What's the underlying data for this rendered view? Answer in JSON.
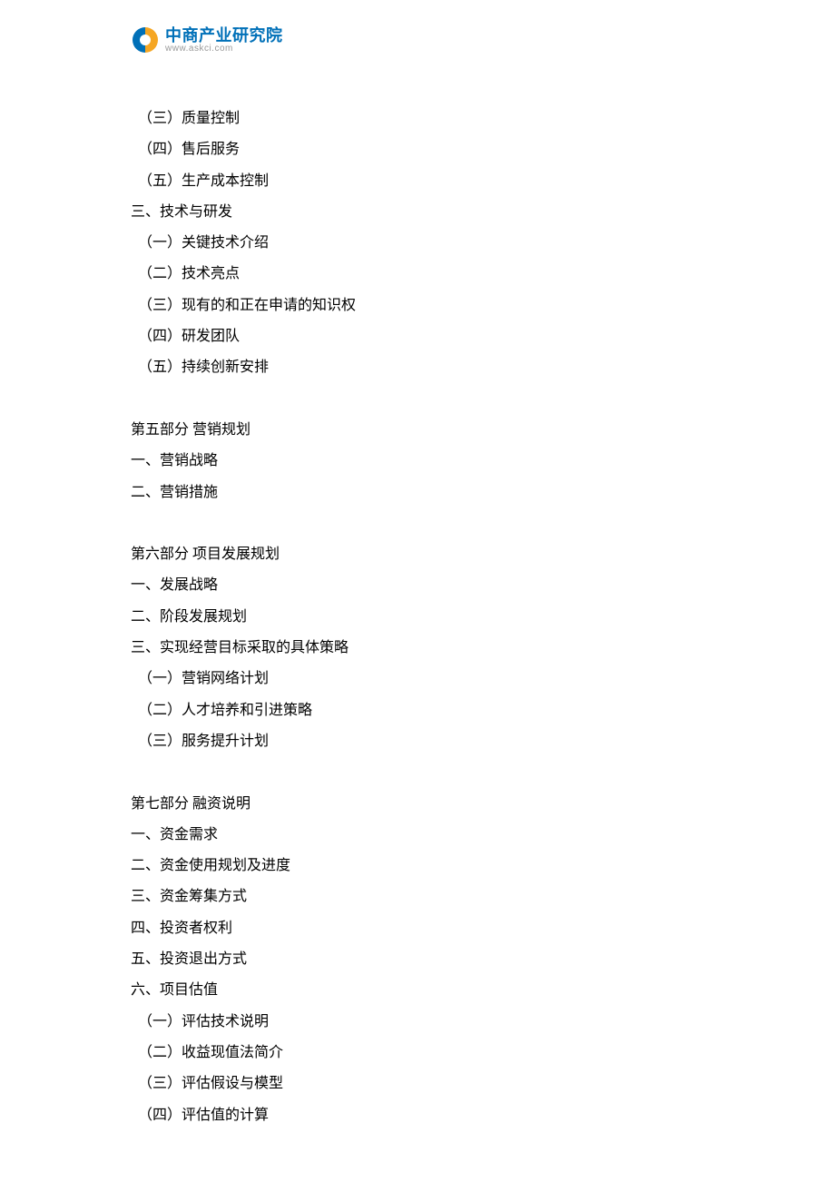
{
  "logo": {
    "chinese": "中商产业研究院",
    "url": "www.askci.com"
  },
  "lines": [
    {
      "text": "（三）质量控制",
      "sub": true
    },
    {
      "text": "（四）售后服务",
      "sub": true
    },
    {
      "text": "（五）生产成本控制",
      "sub": true
    },
    {
      "text": "三、技术与研发",
      "sub": false
    },
    {
      "text": "（一）关键技术介绍",
      "sub": true
    },
    {
      "text": "（二）技术亮点",
      "sub": true
    },
    {
      "text": "（三）现有的和正在申请的知识权",
      "sub": true
    },
    {
      "text": "（四）研发团队",
      "sub": true
    },
    {
      "text": "（五）持续创新安排",
      "sub": true
    },
    {
      "text": "",
      "blank": true
    },
    {
      "text": "第五部分 营销规划",
      "sub": false
    },
    {
      "text": "一、营销战略",
      "sub": false
    },
    {
      "text": "二、营销措施",
      "sub": false
    },
    {
      "text": "",
      "blank": true
    },
    {
      "text": "第六部分 项目发展规划",
      "sub": false
    },
    {
      "text": "一、发展战略",
      "sub": false
    },
    {
      "text": "二、阶段发展规划",
      "sub": false
    },
    {
      "text": "三、实现经营目标采取的具体策略",
      "sub": false
    },
    {
      "text": "（一）营销网络计划",
      "sub": true
    },
    {
      "text": "（二）人才培养和引进策略",
      "sub": true
    },
    {
      "text": "（三）服务提升计划",
      "sub": true
    },
    {
      "text": "",
      "blank": true
    },
    {
      "text": "第七部分 融资说明",
      "sub": false
    },
    {
      "text": "一、资金需求",
      "sub": false
    },
    {
      "text": "二、资金使用规划及进度",
      "sub": false
    },
    {
      "text": "三、资金筹集方式",
      "sub": false
    },
    {
      "text": "四、投资者权利",
      "sub": false
    },
    {
      "text": "五、投资退出方式",
      "sub": false
    },
    {
      "text": "六、项目估值",
      "sub": false
    },
    {
      "text": "（一）评估技术说明",
      "sub": true
    },
    {
      "text": "（二）收益现值法简介",
      "sub": true
    },
    {
      "text": "（三）评估假设与模型",
      "sub": true
    },
    {
      "text": "（四）评估值的计算",
      "sub": true
    }
  ]
}
